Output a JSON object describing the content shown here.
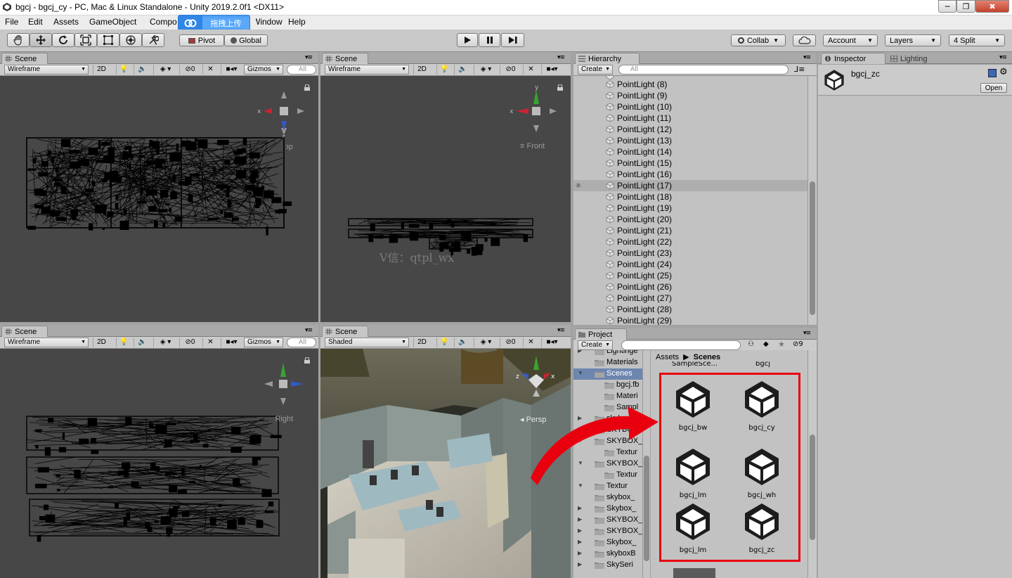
{
  "window": {
    "title": "bgcj - bgcj_cy - PC, Mac & Linux Standalone - Unity 2019.2.0f1 <DX11>",
    "minimize": "─",
    "restore": "❐",
    "close": "✖"
  },
  "menu": [
    "File",
    "Edit",
    "Assets",
    "GameObject",
    "Compo",
    "Window",
    "Help"
  ],
  "upload_badge": {
    "text": "拖拽上传"
  },
  "toolbar": {
    "pivot": "Pivot",
    "global": "Global",
    "collab": "Collab",
    "account": "Account",
    "layers": "Layers",
    "layout": "4 Split"
  },
  "scene_views": [
    {
      "tab": "Scene",
      "mode": "Wireframe",
      "dim": "2D",
      "count": "0",
      "gizmos": "Gizmos",
      "search": "All",
      "axis_label": "Top"
    },
    {
      "tab": "Scene",
      "mode": "Wireframe",
      "dim": "2D",
      "count": "0",
      "gizmos": "",
      "search": "",
      "axis_label": "Front"
    },
    {
      "tab": "Scene",
      "mode": "Wireframe",
      "dim": "2D",
      "count": "0",
      "gizmos": "Gizmos",
      "search": "All",
      "axis_label": "Right"
    },
    {
      "tab": "Scene",
      "mode": "Shaded",
      "dim": "2D",
      "count": "0",
      "gizmos": "",
      "search": "",
      "axis_label": "Persp"
    }
  ],
  "watermark": "V信：qtpl_wx",
  "gizmo_axes": {
    "x": "x",
    "y": "y",
    "z": "z"
  },
  "hierarchy": {
    "tab": "Hierarchy",
    "create": "Create",
    "search": "All",
    "items": [
      "PointLight (8)",
      "PointLight (9)",
      "PointLight (10)",
      "PointLight (11)",
      "PointLight (12)",
      "PointLight (13)",
      "PointLight (14)",
      "PointLight (15)",
      "PointLight (16)",
      "PointLight (17)",
      "PointLight (18)",
      "PointLight (19)",
      "PointLight (20)",
      "PointLight (21)",
      "PointLight (22)",
      "PointLight (23)",
      "PointLight (24)",
      "PointLight (25)",
      "PointLight (26)",
      "PointLight (27)",
      "PointLight (28)",
      "PointLight (29)"
    ],
    "selected_index": 9
  },
  "project": {
    "tab": "Project",
    "create": "Create",
    "hidden_count": "9",
    "breadcrumb": [
      "Assets",
      "Scenes"
    ],
    "tree": [
      {
        "label": "Lightinge",
        "indent": 0,
        "arrow": "▶"
      },
      {
        "label": "Materials",
        "indent": 0,
        "arrow": ""
      },
      {
        "label": "Scenes",
        "indent": 0,
        "arrow": "▼",
        "selected": true
      },
      {
        "label": "bgcj.fb",
        "indent": 1,
        "arrow": ""
      },
      {
        "label": "Materi",
        "indent": 1,
        "arrow": ""
      },
      {
        "label": "Sampl",
        "indent": 1,
        "arrow": ""
      },
      {
        "label": "skybo",
        "indent": 0,
        "arrow": "▶"
      },
      {
        "label": "SKYBO",
        "indent": 0,
        "arrow": "▶"
      },
      {
        "label": "SKYBOX_",
        "indent": 0,
        "arrow": "▼"
      },
      {
        "label": "Textur",
        "indent": 1,
        "arrow": ""
      },
      {
        "label": "SKYBOX_",
        "indent": 0,
        "arrow": "▼"
      },
      {
        "label": "Textur",
        "indent": 1,
        "arrow": ""
      },
      {
        "label": "Textur",
        "indent": 0,
        "arrow": "▼"
      },
      {
        "label": "skybox_",
        "indent": 0,
        "arrow": ""
      },
      {
        "label": "Skybox_",
        "indent": 0,
        "arrow": "▶"
      },
      {
        "label": "SKYBOX_",
        "indent": 0,
        "arrow": "▶"
      },
      {
        "label": "SKYBOX_",
        "indent": 0,
        "arrow": "▶"
      },
      {
        "label": "Skybox_",
        "indent": 0,
        "arrow": "▶"
      },
      {
        "label": "skyboxB",
        "indent": 0,
        "arrow": "▶"
      },
      {
        "label": "SkySeri",
        "indent": 0,
        "arrow": "▶"
      }
    ],
    "top_partial": [
      "SampleSce...",
      "bgcj"
    ],
    "assets": [
      "bgcj_bw",
      "bgcj_cy",
      "bgcj_lm",
      "bgcj_wh",
      "bgcj_lm",
      "bgcj_zc"
    ]
  },
  "inspector": {
    "tab": "Inspector",
    "lighting_tab": "Lighting",
    "object_name": "bgcj_zc",
    "open": "Open"
  },
  "colors": {
    "highlight": "#e8000f",
    "selection": "#6d86b0",
    "badge": "#4e9ef6"
  }
}
